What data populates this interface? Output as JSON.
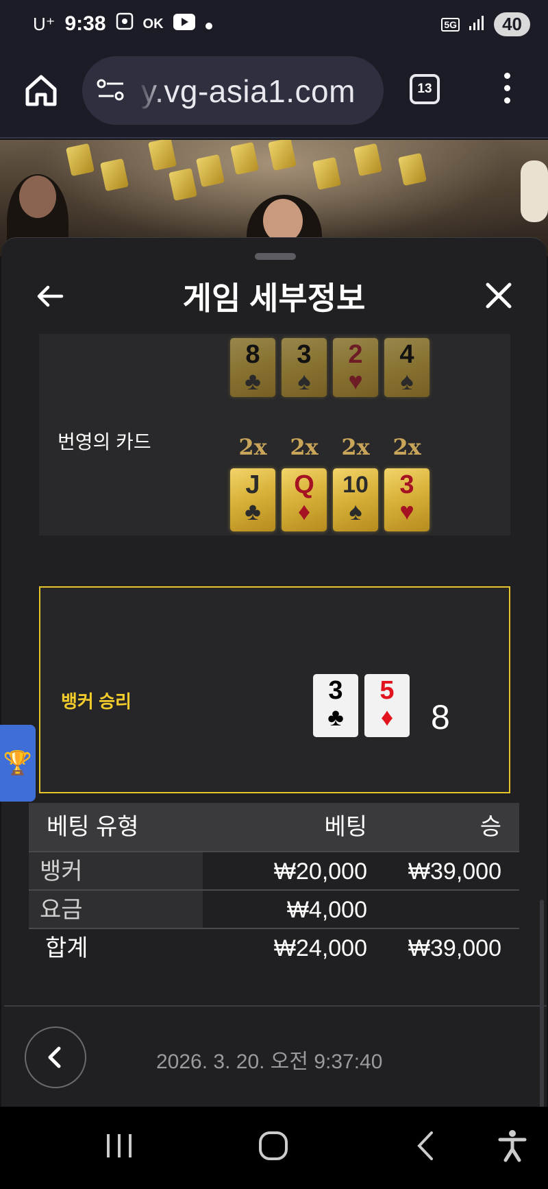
{
  "status_bar": {
    "carrier": "U⁺",
    "time": "9:38",
    "ok_label": "OK",
    "network": "5G",
    "battery": "40"
  },
  "browser": {
    "url": "y.vg-asia1.com",
    "tab_count": "13"
  },
  "sheet": {
    "title": "게임 세부정보",
    "banker_cards_label": "번영의 카드",
    "top_row_cards": [
      {
        "rank": "8",
        "suit": "♣",
        "color": "black"
      },
      {
        "rank": "3",
        "suit": "♠",
        "color": "black"
      },
      {
        "rank": "2",
        "suit": "♥",
        "color": "red"
      },
      {
        "rank": "4",
        "suit": "♠",
        "color": "black"
      }
    ],
    "multipliers": [
      "2x",
      "2x",
      "2x",
      "2x"
    ],
    "lucky_cards": [
      {
        "rank": "J",
        "suit": "♣",
        "color": "black"
      },
      {
        "rank": "Q",
        "suit": "♦",
        "color": "red"
      },
      {
        "rank": "10",
        "suit": "♠",
        "color": "black"
      },
      {
        "rank": "3",
        "suit": "♥",
        "color": "red"
      }
    ],
    "result": {
      "label": "뱅커 승리",
      "cards": [
        {
          "rank": "3",
          "suit": "♣",
          "color": "black"
        },
        {
          "rank": "5",
          "suit": "♦",
          "color": "red"
        }
      ],
      "score": "8"
    },
    "bet_table": {
      "headers": [
        "베팅 유형",
        "베팅",
        "승"
      ],
      "rows": [
        {
          "type": "뱅커",
          "bet": "₩20,000",
          "win": "₩39,000"
        },
        {
          "type": "요금",
          "bet": "₩4,000",
          "win": ""
        }
      ],
      "total": {
        "type": "합계",
        "bet": "₩24,000",
        "win": "₩39,000"
      }
    },
    "timestamp": "2026. 3. 20. 오전 9:37:40"
  },
  "colors": {
    "accent_gold": "#e5c52a",
    "result_label": "#f2cc2c",
    "trophy_tab": "#3f6fd6"
  }
}
